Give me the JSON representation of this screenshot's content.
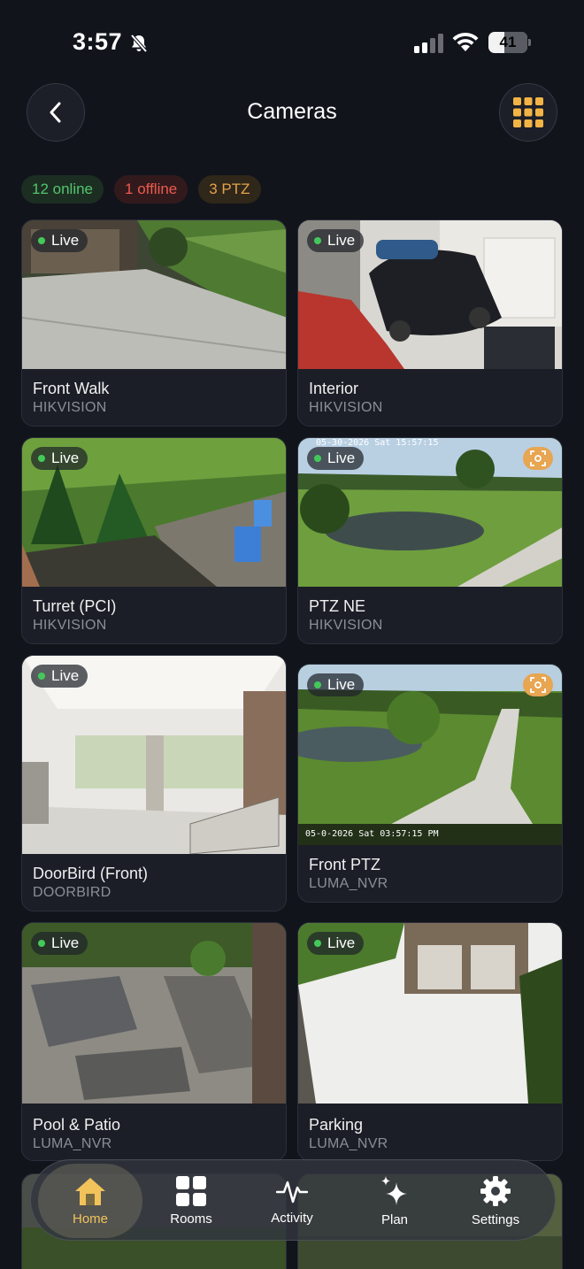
{
  "status_bar": {
    "time": "3:57",
    "battery": "41",
    "battery_level": 0.41
  },
  "header": {
    "title": "Cameras"
  },
  "badges": {
    "online": "12 online",
    "offline": "1 offline",
    "ptz": "3 PTZ"
  },
  "live_label": "Live",
  "cameras": [
    {
      "name": "Front Walk",
      "brand": "HIKVISION",
      "ptz": false
    },
    {
      "name": "Interior",
      "brand": "HIKVISION",
      "ptz": false
    },
    {
      "name": "Turret (PCI)",
      "brand": "HIKVISION",
      "ptz": false
    },
    {
      "name": "PTZ NE",
      "brand": "HIKVISION",
      "ptz": true,
      "osd": "05-30-2026 Sat 15:57:15"
    },
    {
      "name": "DoorBird (Front)",
      "brand": "DOORBIRD",
      "ptz": false
    },
    {
      "name": "Front PTZ",
      "brand": "LUMA_NVR",
      "ptz": true,
      "osd": "05-0-2026 Sat 03:57:15 PM"
    },
    {
      "name": "Pool & Patio",
      "brand": "LUMA_NVR",
      "ptz": false
    },
    {
      "name": "Parking",
      "brand": "LUMA_NVR",
      "ptz": false
    }
  ],
  "tabs": [
    {
      "label": "Home",
      "icon": "house-icon",
      "active": true
    },
    {
      "label": "Rooms",
      "icon": "grid-icon"
    },
    {
      "label": "Activity",
      "icon": "pulse-icon"
    },
    {
      "label": "Plan",
      "icon": "sparkles-icon"
    },
    {
      "label": "Settings",
      "icon": "gear-icon"
    }
  ],
  "colors": {
    "online": "#54c46e",
    "offline": "#ec5a4e",
    "ptz": "#e5a24c",
    "accent": "#f2c35a"
  }
}
